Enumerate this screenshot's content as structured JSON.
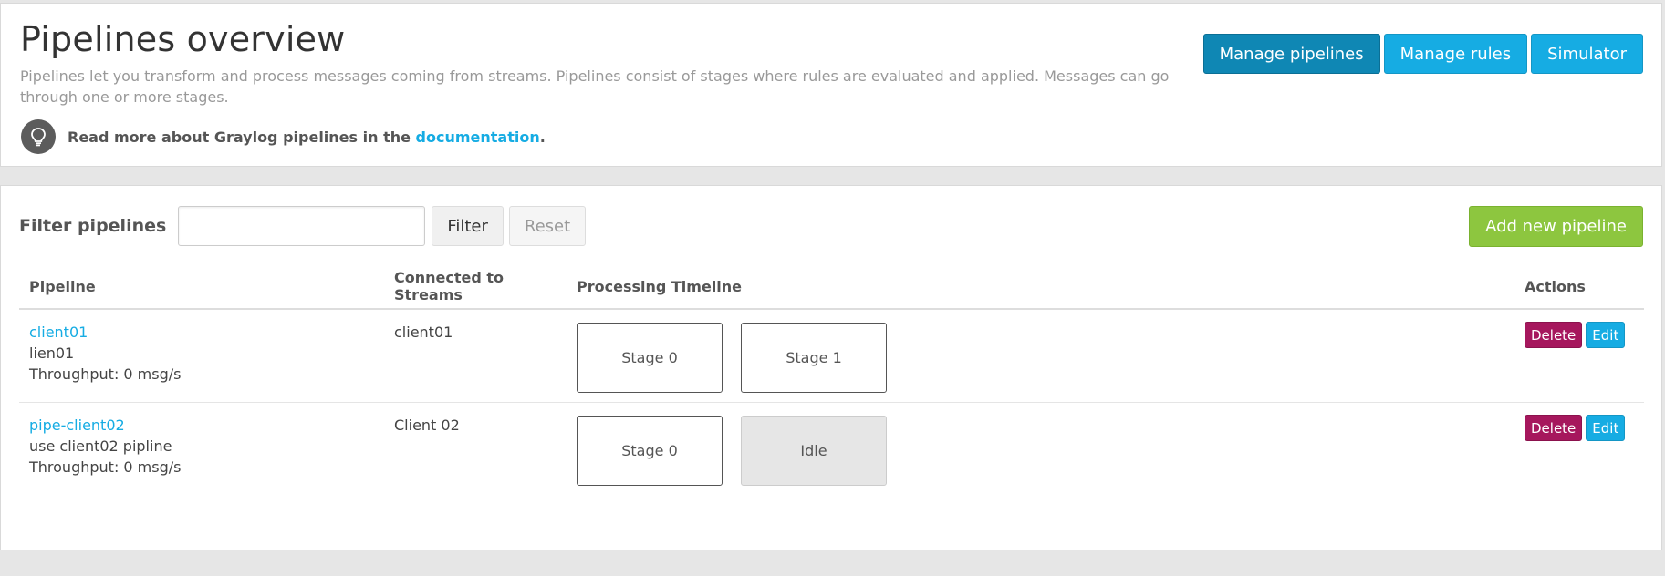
{
  "header": {
    "title": "Pipelines overview",
    "description": "Pipelines let you transform and process messages coming from streams. Pipelines consist of stages where rules are evaluated and applied. Messages can go through one or more stages.",
    "doc_prefix": "Read more about Graylog pipelines in the ",
    "doc_link": "documentation",
    "doc_suffix": ".",
    "buttons": {
      "manage_pipelines": "Manage pipelines",
      "manage_rules": "Manage rules",
      "simulator": "Simulator"
    }
  },
  "filter": {
    "label": "Filter pipelines",
    "input_value": "",
    "filter_label": "Filter",
    "reset_label": "Reset",
    "add_label": "Add new pipeline"
  },
  "table": {
    "columns": {
      "pipeline": "Pipeline",
      "streams": "Connected to Streams",
      "timeline": "Processing Timeline",
      "actions": "Actions"
    },
    "rows": [
      {
        "name": "client01",
        "description": "lien01",
        "throughput": "Throughput: 0 msg/s",
        "streams": "client01",
        "stages": [
          "Stage 0",
          "Stage 1"
        ],
        "delete": "Delete",
        "edit": "Edit"
      },
      {
        "name": "pipe-client02",
        "description": "use client02 pipline",
        "throughput": "Throughput: 0 msg/s",
        "streams": "Client 02",
        "stages": [
          "Stage 0",
          "Idle"
        ],
        "delete": "Delete",
        "edit": "Edit"
      }
    ]
  },
  "colors": {
    "info": "#16ace3",
    "success": "#8dc63f",
    "danger": "#a6175d"
  },
  "icons": {
    "doc_hint": "lightbulb-icon"
  }
}
